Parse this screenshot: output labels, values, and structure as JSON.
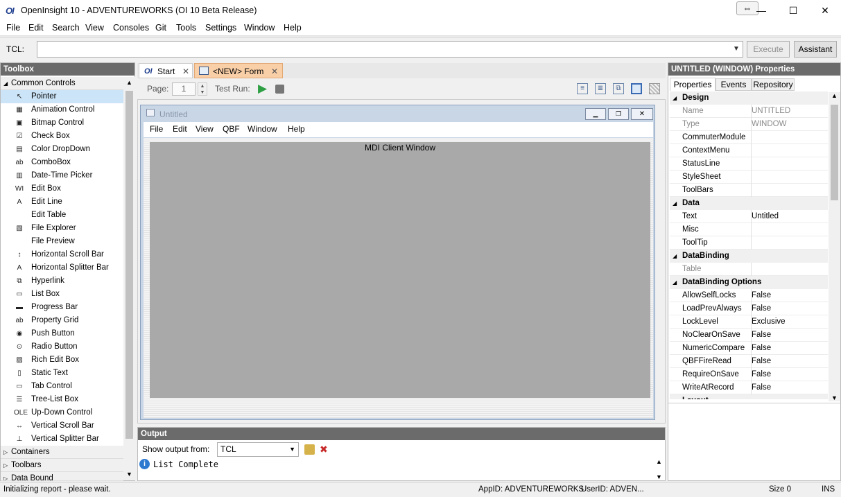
{
  "window": {
    "logo": "OI",
    "title": "OpenInsight 10 - ADVENTUREWORKS (OI 10 Beta Release)",
    "resize_glyph": "⇔",
    "minimize": "—",
    "maximize": "☐",
    "close": "✕"
  },
  "menu": [
    "File",
    "Edit",
    "Search",
    "View",
    "Consoles",
    "Git",
    "Tools",
    "Settings",
    "Window",
    "Help"
  ],
  "tcl": {
    "label": "TCL:",
    "value": "",
    "execute_label": "Execute",
    "assistant_label": "Assistant"
  },
  "toolbox": {
    "title": "Toolbox",
    "section_common": "Common Controls",
    "items": [
      {
        "label": "Pointer",
        "icon": "pointer-icon",
        "glyph": "↖"
      },
      {
        "label": "Animation Control",
        "icon": "film-icon",
        "glyph": "▦"
      },
      {
        "label": "Bitmap Control",
        "icon": "image-icon",
        "glyph": "▣"
      },
      {
        "label": "Check Box",
        "icon": "checkbox-icon",
        "glyph": "☑"
      },
      {
        "label": "Color DropDown",
        "icon": "palette-icon",
        "glyph": "▤"
      },
      {
        "label": "ComboBox",
        "icon": "combobox-icon",
        "glyph": "ab"
      },
      {
        "label": "Date-Time Picker",
        "icon": "calendar-icon",
        "glyph": "▥"
      },
      {
        "label": "Edit Box",
        "icon": "editbox-icon",
        "glyph": "WI"
      },
      {
        "label": "Edit Line",
        "icon": "editline-icon",
        "glyph": "A"
      },
      {
        "label": "Edit Table",
        "icon": "table-icon",
        "glyph": ""
      },
      {
        "label": "File Explorer",
        "icon": "folder-icon",
        "glyph": "▧"
      },
      {
        "label": "File Preview",
        "icon": "file-preview-icon",
        "glyph": ""
      },
      {
        "label": "Horizontal Scroll Bar",
        "icon": "hscroll-icon",
        "glyph": "↕"
      },
      {
        "label": "Horizontal Splitter Bar",
        "icon": "hsplitter-icon",
        "glyph": "A"
      },
      {
        "label": "Hyperlink",
        "icon": "hyperlink-icon",
        "glyph": "⧉"
      },
      {
        "label": "List Box",
        "icon": "listbox-icon",
        "glyph": "▭"
      },
      {
        "label": "Progress Bar",
        "icon": "progressbar-icon",
        "glyph": "▬"
      },
      {
        "label": "Property Grid",
        "icon": "propertygrid-icon",
        "glyph": "ab"
      },
      {
        "label": "Push Button",
        "icon": "pushbutton-icon",
        "glyph": "◉"
      },
      {
        "label": "Radio Button",
        "icon": "radio-icon",
        "glyph": "⊙"
      },
      {
        "label": "Rich Edit Box",
        "icon": "richedit-icon",
        "glyph": "▨"
      },
      {
        "label": "Static Text",
        "icon": "statictext-icon",
        "glyph": "▯"
      },
      {
        "label": "Tab Control",
        "icon": "tabcontrol-icon",
        "glyph": "▭"
      },
      {
        "label": "Tree-List Box",
        "icon": "treelist-icon",
        "glyph": "☰"
      },
      {
        "label": "Up-Down Control",
        "icon": "updown-icon",
        "glyph": "OLE"
      },
      {
        "label": "Vertical Scroll Bar",
        "icon": "vscroll-icon",
        "glyph": "↔"
      },
      {
        "label": "Vertical Splitter Bar",
        "icon": "vsplitter-icon",
        "glyph": "⊥"
      }
    ],
    "sections_collapsed": [
      "Containers",
      "Toolbars",
      "Data Bound"
    ]
  },
  "doc_tabs": [
    {
      "label": "Start",
      "icon": "oi-logo-icon"
    },
    {
      "label": "<NEW> Form",
      "icon": "form-icon"
    }
  ],
  "form_toolbar": {
    "page_label": "Page:",
    "page_value": "1",
    "testrun_label": "Test Run:"
  },
  "form": {
    "title": "Untitled",
    "menu": [
      "File",
      "Edit",
      "View",
      "QBF",
      "Window",
      "Help"
    ],
    "mdi_label": "MDI Client Window"
  },
  "output": {
    "title": "Output",
    "show_label": "Show output from:",
    "source": "TCL",
    "message": "List Complete"
  },
  "properties": {
    "title": "UNTITLED (WINDOW) Properties",
    "tabs": [
      "Properties",
      "Events",
      "Repository"
    ],
    "groups": [
      {
        "name": "Design",
        "rows": [
          {
            "n": "Name",
            "v": "UNTITLED",
            "disabled": true
          },
          {
            "n": "Type",
            "v": "WINDOW",
            "disabled": true
          },
          {
            "n": "CommuterModule",
            "v": ""
          },
          {
            "n": "ContextMenu",
            "v": ""
          },
          {
            "n": "StatusLine",
            "v": ""
          },
          {
            "n": "StyleSheet",
            "v": ""
          },
          {
            "n": "ToolBars",
            "v": ""
          }
        ]
      },
      {
        "name": "Data",
        "rows": [
          {
            "n": "Text",
            "v": "Untitled"
          },
          {
            "n": "Misc",
            "v": ""
          },
          {
            "n": "ToolTip",
            "v": ""
          }
        ]
      },
      {
        "name": "DataBinding",
        "rows": [
          {
            "n": "Table",
            "v": "",
            "disabled": true
          }
        ]
      },
      {
        "name": "DataBinding Options",
        "rows": [
          {
            "n": "AllowSelfLocks",
            "v": "False"
          },
          {
            "n": "LoadPrevAlways",
            "v": "False"
          },
          {
            "n": "LockLevel",
            "v": "Exclusive"
          },
          {
            "n": "NoClearOnSave",
            "v": "False"
          },
          {
            "n": "NumericCompare",
            "v": "False"
          },
          {
            "n": "QBFFireRead",
            "v": "False"
          },
          {
            "n": "RequireOnSave",
            "v": "False"
          },
          {
            "n": "WriteAtRecord",
            "v": "False"
          }
        ]
      }
    ],
    "cut_off_group": "Layout"
  },
  "status": {
    "message": "Initializing report - please wait.",
    "appid": "AppID: ADVENTUREWORKS",
    "userid": "UserID: ADVEN...",
    "size": "Size 0",
    "mode": "INS"
  },
  "colors": {
    "selection": "#cce4f7",
    "panel_header": "#6b6b6b",
    "active_tab": "#f9cfa8",
    "mdi_gray": "#a9a9a9",
    "play_green": "#2ea043"
  }
}
